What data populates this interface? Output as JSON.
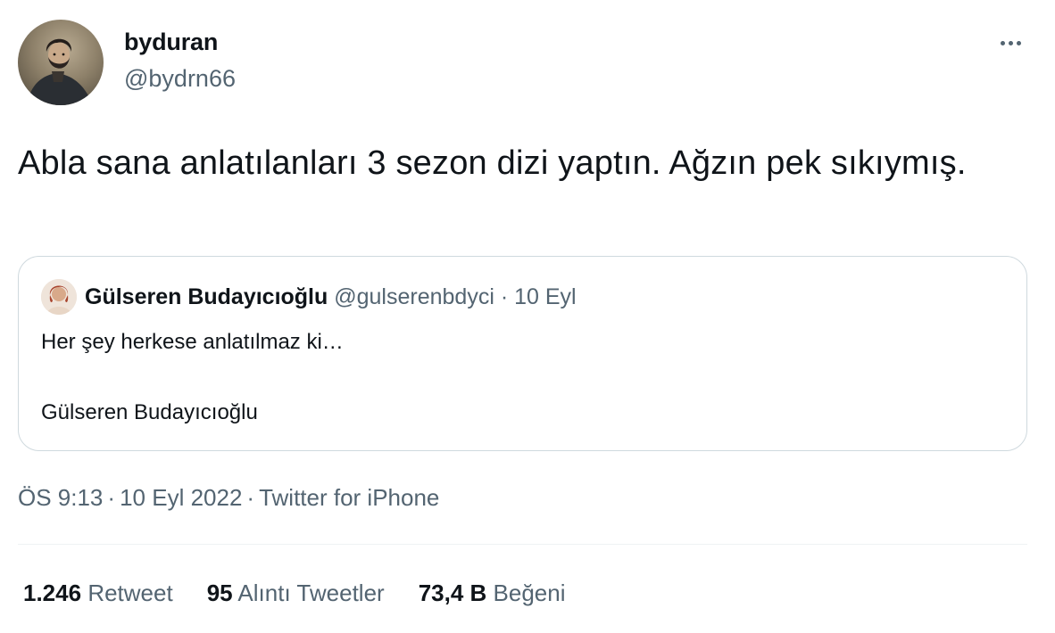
{
  "author": {
    "display_name": "byduran",
    "handle": "@bydrn66",
    "avatar_icon": "profile-portrait"
  },
  "tweet": {
    "text": "Abla sana anlatılanları 3 sezon dizi yaptın. Ağzın pek sıkıymış."
  },
  "quoted_tweet": {
    "display_name": "Gülseren Budayıcıoğlu",
    "handle": "@gulserenbdyci",
    "date": "10 Eyl",
    "separator": "·",
    "line1": "Her şey herkese anlatılmaz ki…",
    "line2": "Gülseren Budayıcıoğlu"
  },
  "meta": {
    "time": "ÖS 9:13",
    "date": "10 Eyl 2022",
    "source": "Twitter for iPhone",
    "separator": "·"
  },
  "stats": {
    "retweets_count": "1.246",
    "retweets_label": "Retweet",
    "quotes_count": "95",
    "quotes_label": "Alıntı Tweetler",
    "likes_count": "73,4 B",
    "likes_label": "Beğeni"
  },
  "colors": {
    "text_primary": "#0f1419",
    "text_secondary": "#536471",
    "border": "#cfd9de"
  },
  "icons": {
    "more": "more-horizontal-icon"
  }
}
